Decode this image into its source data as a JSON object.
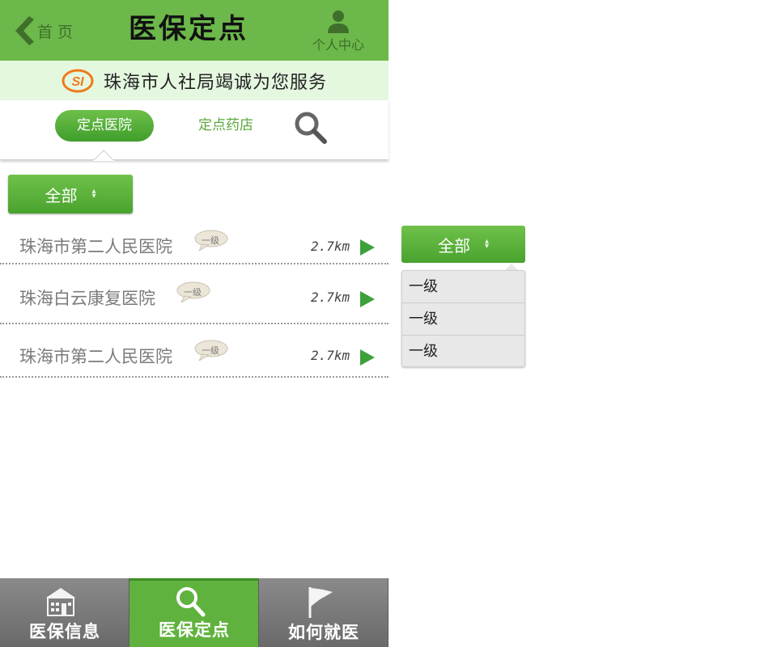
{
  "header": {
    "back_label": "首 页",
    "title": "医保定点",
    "user_label": "个人中心"
  },
  "banner": {
    "logo_text": "SI",
    "text": "珠海市人社局竭诚为您服务"
  },
  "tabs": {
    "active": "定点医院",
    "inactive": "定点药店",
    "search_icon": "search-icon"
  },
  "filter": {
    "label": "全部"
  },
  "hospitals": [
    {
      "name": "珠海市第二人民医院",
      "level": "一级",
      "distance": "2.7km"
    },
    {
      "name": "珠海白云康复医院",
      "level": "一级",
      "distance": "2.7km"
    },
    {
      "name": "珠海市第二人民医院",
      "level": "一级",
      "distance": "2.7km"
    }
  ],
  "dropdown": {
    "label": "全部",
    "options": [
      "一级",
      "一级",
      "一级"
    ]
  },
  "bottom_nav": [
    {
      "label": "医保信息",
      "icon": "building-icon"
    },
    {
      "label": "医保定点",
      "icon": "search-icon",
      "active": true
    },
    {
      "label": "如何就医",
      "icon": "flag-icon"
    }
  ],
  "colors": {
    "header_green": "#6cb84a",
    "banner_bg": "#e4f8e0",
    "accent_green": "#49a32e",
    "nav_gray": "#7a7a7a"
  }
}
